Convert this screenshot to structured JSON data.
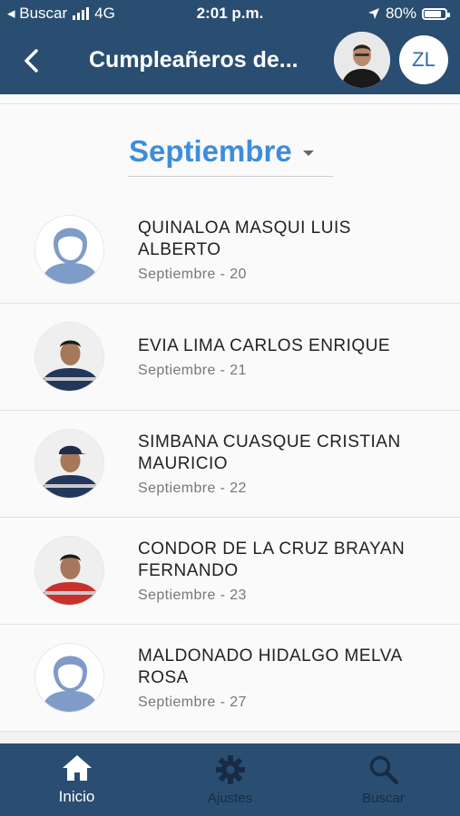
{
  "status_bar": {
    "back_app": "◂ Buscar",
    "network": "4G",
    "time": "2:01 p.m.",
    "battery": "80%",
    "battery_level": 0.8
  },
  "app_bar": {
    "title": "Cumpleañeros de...",
    "user_initials": "ZL"
  },
  "month_selector": {
    "selected": "Septiembre"
  },
  "birthdays": [
    {
      "name": "QUINALOA MASQUI LUIS ALBERTO",
      "date": "Septiembre - 20",
      "photo": "placeholder"
    },
    {
      "name": "EVIA LIMA CARLOS ENRIQUE",
      "date": "Septiembre - 21",
      "photo": "worker-navy"
    },
    {
      "name": "SIMBANA CUASQUE CRISTIAN MAURICIO",
      "date": "Septiembre - 22",
      "photo": "worker-navy-cap"
    },
    {
      "name": "CONDOR DE LA CRUZ BRAYAN FERNANDO",
      "date": "Septiembre - 23",
      "photo": "worker-red"
    },
    {
      "name": "MALDONADO HIDALGO MELVA ROSA",
      "date": "Septiembre - 27",
      "photo": "placeholder"
    }
  ],
  "bottom_nav": {
    "items": [
      {
        "label": "Inicio",
        "icon": "home-icon",
        "active": true
      },
      {
        "label": "Ajustes",
        "icon": "gear-icon",
        "active": false
      },
      {
        "label": "Buscar",
        "icon": "search-icon",
        "active": false
      }
    ]
  },
  "colors": {
    "primary": "#2a4e72",
    "accent": "#3d8ddc"
  }
}
